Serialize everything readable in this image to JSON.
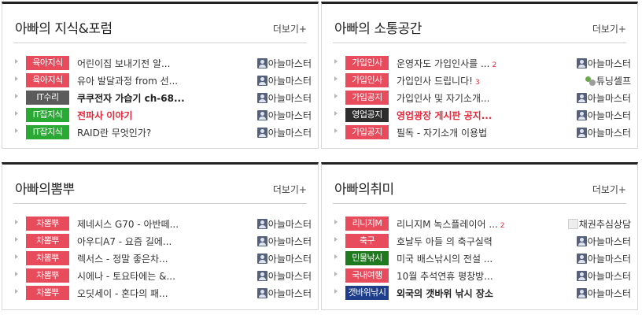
{
  "colors": {
    "panel_top_border": "#222222",
    "comment_count": "#e5283a",
    "category_red": "#e84b5b",
    "category_gray": "#5b5b5b",
    "category_green": "#2aa935",
    "category_dark": "#2d2d2d",
    "category_darkgreen": "#1f7a1f",
    "category_navy": "#1e3d8a"
  },
  "panels": [
    {
      "title": "아빠의 지식&포럼",
      "more_label": "더보기+",
      "rows": [
        {
          "category": "육아지식",
          "category_color": "#e84b5b",
          "subject": "어린이집 보내기전 알...",
          "style": "normal",
          "comments": "",
          "author": "아늘마스터",
          "author_icon": "member-icon"
        },
        {
          "category": "육아지식",
          "category_color": "#e84b5b",
          "subject": "유아 발달과정 from 선...",
          "style": "normal",
          "comments": "",
          "author": "아늘마스터",
          "author_icon": "member-icon"
        },
        {
          "category": "IT수리",
          "category_color": "#5b5b5b",
          "subject": "쿠쿠전자 가습기 ch-68...",
          "style": "bold",
          "comments": "",
          "author": "아늘마스터",
          "author_icon": "member-icon"
        },
        {
          "category": "IT잡지식",
          "category_color": "#2aa935",
          "subject": "전파사 이야기",
          "style": "red",
          "comments": "",
          "author": "아늘마스터",
          "author_icon": "member-icon"
        },
        {
          "category": "IT잡지식",
          "category_color": "#2aa935",
          "subject": "RAID란 무엇인가?",
          "style": "normal",
          "comments": "",
          "author": "아늘마스터",
          "author_icon": "member-icon"
        }
      ]
    },
    {
      "title": "아빠의 소통공간",
      "more_label": "더보기+",
      "rows": [
        {
          "category": "가입인사",
          "category_color": "#e84b5b",
          "subject": "운영자도 가입인사를 ...",
          "style": "normal",
          "comments": "2",
          "author": "아늘마스터",
          "author_icon": "member-icon"
        },
        {
          "category": "가입인사",
          "category_color": "#e84b5b",
          "subject": "가입인사 드립니다!",
          "style": "normal",
          "comments": "3",
          "author": "튜닝셀프",
          "author_icon": "level-icon"
        },
        {
          "category": "가입공지",
          "category_color": "#e84b5b",
          "subject": "가입인사 및 자기소개...",
          "style": "normal",
          "comments": "",
          "author": "아늘마스터",
          "author_icon": "member-icon"
        },
        {
          "category": "영업공지",
          "category_color": "#2d2d2d",
          "subject": "영업광장 게시판 공지...",
          "style": "red",
          "comments": "",
          "author": "아늘마스터",
          "author_icon": "member-icon"
        },
        {
          "category": "가입공지",
          "category_color": "#e84b5b",
          "subject": "필독 - 자기소개 이용법",
          "style": "normal",
          "comments": "",
          "author": "아늘마스터",
          "author_icon": "member-icon"
        }
      ]
    },
    {
      "title": "아빠의뽐뿌",
      "more_label": "더보기+",
      "rows": [
        {
          "category": "차뽐뿌",
          "category_color": "#e84b5b",
          "subject": "제네시스 G70 - 아반떼...",
          "style": "normal",
          "comments": "",
          "author": "아늘마스터",
          "author_icon": "member-icon"
        },
        {
          "category": "차뽐뿌",
          "category_color": "#e84b5b",
          "subject": "아우디A7 - 요즘 길에...",
          "style": "normal",
          "comments": "",
          "author": "아늘마스터",
          "author_icon": "member-icon"
        },
        {
          "category": "차뽐뿌",
          "category_color": "#e84b5b",
          "subject": "렉서스 - 정말 좋은차...",
          "style": "normal",
          "comments": "",
          "author": "아늘마스터",
          "author_icon": "member-icon"
        },
        {
          "category": "차뽐뿌",
          "category_color": "#e84b5b",
          "subject": "시에나 - 토요타에는 &...",
          "style": "normal",
          "comments": "",
          "author": "아늘마스터",
          "author_icon": "member-icon"
        },
        {
          "category": "차뽐뿌",
          "category_color": "#e84b5b",
          "subject": "오딧세이 - 혼다의 패...",
          "style": "normal",
          "comments": "",
          "author": "아늘마스터",
          "author_icon": "member-icon"
        }
      ]
    },
    {
      "title": "아빠의취미",
      "more_label": "더보기+",
      "rows": [
        {
          "category": "리니지M",
          "category_color": "#e84b5b",
          "subject": "리니지M 녹스플레이어 ...",
          "style": "normal",
          "comments": "2",
          "author": "채권추심상담",
          "author_icon": "blank-icon"
        },
        {
          "category": "축구",
          "category_color": "#e84b5b",
          "subject": "호날두 아들 의 축구실력",
          "style": "normal",
          "comments": "",
          "author": "아늘마스터",
          "author_icon": "member-icon"
        },
        {
          "category": "민물낚시",
          "category_color": "#1f7a1f",
          "subject": "미국 배스낚시의 전설 ...",
          "style": "normal",
          "comments": "",
          "author": "아늘마스터",
          "author_icon": "member-icon"
        },
        {
          "category": "국내여행",
          "category_color": "#e84b5b",
          "subject": "10월 추석연휴 평창방...",
          "style": "normal",
          "comments": "",
          "author": "아늘마스터",
          "author_icon": "member-icon"
        },
        {
          "category": "갯바위낚시",
          "category_color": "#1e3d8a",
          "subject": "외국의 갯바위 낚시 장소",
          "style": "bold",
          "comments": "",
          "author": "아늘마스터",
          "author_icon": "member-icon"
        }
      ]
    }
  ]
}
